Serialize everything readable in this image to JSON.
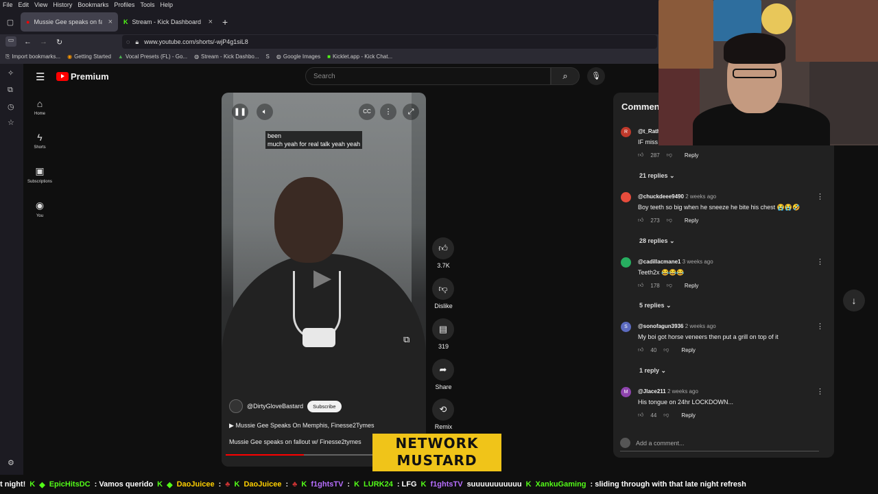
{
  "browser": {
    "menu": [
      "File",
      "Edit",
      "View",
      "History",
      "Bookmarks",
      "Profiles",
      "Tools",
      "Help"
    ],
    "tabs": [
      {
        "title": "Mussie Gee speaks on fallo",
        "active": true
      },
      {
        "title": "Stream - Kick Dashboard",
        "active": false
      }
    ],
    "url": "www.youtube.com/shorts/-wjP4g1siL8",
    "bookmarks": [
      "Import bookmarks...",
      "Getting Started",
      "Vocal Presets (FL) - Go...",
      "Stream - Kick Dashbo...",
      "Google Images",
      "Kicklet.app - Kick Chat..."
    ]
  },
  "youtube": {
    "logo_text": "Premium",
    "search_placeholder": "Search",
    "nav": [
      {
        "label": "Home",
        "icon": "home-icon"
      },
      {
        "label": "Shorts",
        "icon": "shorts-icon"
      },
      {
        "label": "Subscriptions",
        "icon": "subscriptions-icon"
      },
      {
        "label": "You",
        "icon": "you-icon"
      }
    ]
  },
  "video": {
    "caption_line1": "been",
    "caption_line2": "much yeah for real talk yeah yeah",
    "channel": "@DirtyGloveBastard",
    "subscribe": "Subscribe",
    "playlist": "Mussie Gee Speaks On Memphis, Finesse2Tymes",
    "title": "Mussie Gee speaks on fallout w/ Finesse2tymes",
    "progress": 0.4
  },
  "actions": [
    {
      "label": "3.7K",
      "icon": "like-icon"
    },
    {
      "label": "Dislike",
      "icon": "dislike-icon"
    },
    {
      "label": "319",
      "icon": "comment-icon"
    },
    {
      "label": "Share",
      "icon": "share-icon"
    },
    {
      "label": "Remix",
      "icon": "remix-icon"
    }
  ],
  "comments": {
    "title": "Comment",
    "items": [
      {
        "initial": "R",
        "color": "#c0392b",
        "user": "@t_Rath",
        "time": "",
        "text": "IF miss",
        "likes": "287",
        "replies": "21 replies"
      },
      {
        "initial": "",
        "color": "#e74c3c",
        "user": "@chuckdeee9490",
        "time": "2 weeks ago",
        "text": "Boy teeth so big when he sneeze he bite his chest 😭😭🤣",
        "likes": "273",
        "replies": "28 replies"
      },
      {
        "initial": "",
        "color": "#27ae60",
        "user": "@cadillacmane1",
        "time": "3 weeks ago",
        "text": "Teeth2x 😂😂😂",
        "likes": "178",
        "replies": "5 replies"
      },
      {
        "initial": "S",
        "color": "#5c6bc0",
        "user": "@sonofagun3936",
        "time": "2 weeks ago",
        "text": "My boi got horse veneers then put a grill on top of it",
        "likes": "40",
        "replies": "1 reply"
      },
      {
        "initial": "M",
        "color": "#8e44ad",
        "user": "@Jlace211",
        "time": "2 weeks ago",
        "text": "His tongue on 24hr LOCKDOWN...",
        "likes": "44",
        "replies": ""
      }
    ],
    "reply_label": "Reply",
    "add_placeholder": "Add a comment..."
  },
  "overlay": {
    "logo_line1": "NETWORK",
    "logo_line2": "MUSTARD"
  },
  "chat": [
    {
      "user": "",
      "msg": "t night!"
    },
    {
      "user": "EpicHitsDC",
      "msg": ": Vamos querido"
    },
    {
      "user": "DaoJuicee",
      "msg": ":"
    },
    {
      "user": "DaoJuicee",
      "msg": ":"
    },
    {
      "user": "LURK24",
      "msg": ": LFG"
    },
    {
      "user": "",
      "msg": "suuuuuuuuuuu"
    },
    {
      "user": "XankuGaming",
      "msg": ": sliding through with that late night refresh"
    }
  ]
}
